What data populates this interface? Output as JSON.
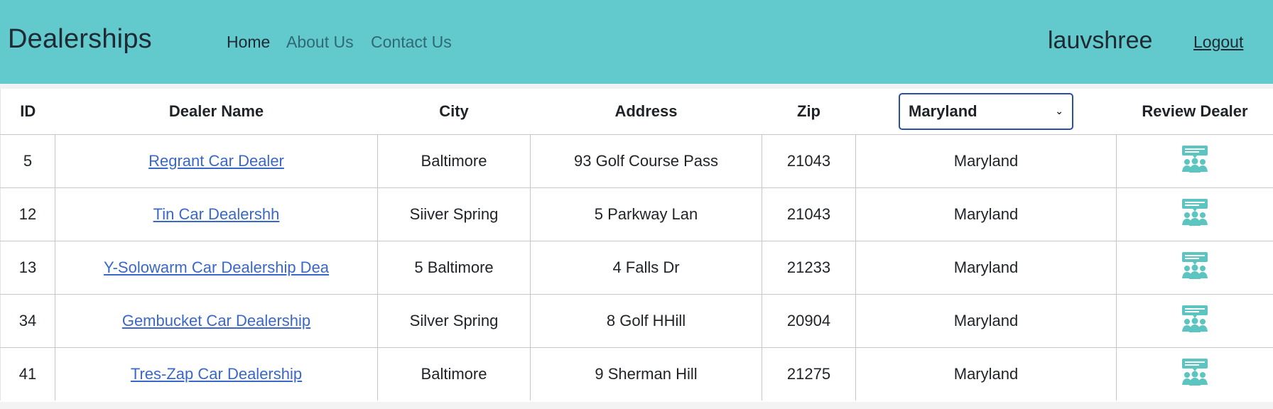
{
  "nav": {
    "brand": "Dealerships",
    "links": [
      {
        "label": "Home"
      },
      {
        "label": "About Us"
      },
      {
        "label": "Contact Us"
      }
    ],
    "username": "lauvshree",
    "logout": "Logout"
  },
  "table": {
    "headers": {
      "id": "ID",
      "dealer_name": "Dealer Name",
      "city": "City",
      "address": "Address",
      "zip": "Zip",
      "review": "Review Dealer"
    },
    "state_filter": {
      "selected": "Maryland"
    },
    "rows": [
      {
        "id": "5",
        "name": "Regrant Car Dealer",
        "city": "Baltimore",
        "address": "93 Golf Course Pass",
        "zip": "21043",
        "state": "Maryland"
      },
      {
        "id": "12",
        "name": "Tin Car Dealershh",
        "city": "Siiver Spring",
        "address": "5 Parkway Lan",
        "zip": "21043",
        "state": "Maryland"
      },
      {
        "id": "13",
        "name": "Y-Solowarm Car Dealership Dea",
        "city": "5 Baltimore",
        "address": "4 Falls Dr",
        "zip": "21233",
        "state": "Maryland"
      },
      {
        "id": "34",
        "name": "Gembucket Car Dealership",
        "city": "Silver Spring",
        "address": "8 Golf HHill",
        "zip": "20904",
        "state": "Maryland"
      },
      {
        "id": "41",
        "name": "Tres-Zap Car Dealership",
        "city": "Baltimore",
        "address": "9 Sherman Hill",
        "zip": "21275",
        "state": "Maryland"
      }
    ]
  },
  "colors": {
    "navbar": "#62c9cd",
    "link": "#3a68c8",
    "icon": "#5cc5c1",
    "select_border": "#2a4fa8"
  },
  "icons": {
    "review": "review-dealer-icon",
    "select_arrow": "chevron-down-icon"
  }
}
